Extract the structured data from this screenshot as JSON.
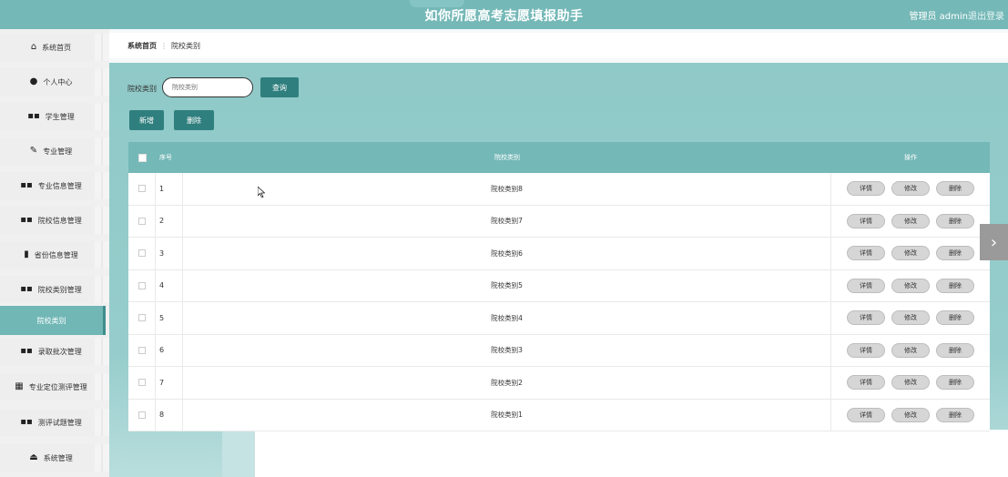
{
  "header": {
    "title": "如你所愿高考志愿填报助手",
    "admin_label": "管理员 admin",
    "logout_label": "退出登录"
  },
  "sidebar": {
    "items": [
      {
        "label": "系统首页",
        "icon": "home-icon"
      },
      {
        "label": "个人中心",
        "icon": "user-icon"
      },
      {
        "label": "学生管理",
        "icon": "grid-icon"
      },
      {
        "label": "专业管理",
        "icon": "edit-icon"
      },
      {
        "label": "专业信息管理",
        "icon": "grid-icon"
      },
      {
        "label": "院校信息管理",
        "icon": "grid-icon"
      },
      {
        "label": "省份信息管理",
        "icon": "chart-icon"
      },
      {
        "label": "院校类别管理",
        "icon": "grid-icon"
      },
      {
        "label": "录取批次管理",
        "icon": "grid-icon"
      },
      {
        "label": "专业定位测评管理",
        "icon": "table-icon"
      },
      {
        "label": "测评试题管理",
        "icon": "grid-icon"
      },
      {
        "label": "系统管理",
        "icon": "system-icon"
      }
    ],
    "active_sub": "院校类别"
  },
  "breadcrumb": {
    "home": "系统首页",
    "separator": "⋮",
    "current": "院校类别"
  },
  "search": {
    "label": "院校类别",
    "placeholder": "院校类别",
    "query_button": "查询"
  },
  "actions": {
    "add_button": "新增",
    "delete_button": "删除"
  },
  "table": {
    "headers": {
      "index": "序号",
      "name": "院校类别",
      "ops": "操作"
    },
    "op_labels": {
      "detail": "详情",
      "edit": "修改",
      "delete": "删除"
    },
    "rows": [
      {
        "index": "1",
        "name": "院校类别8"
      },
      {
        "index": "2",
        "name": "院校类别7"
      },
      {
        "index": "3",
        "name": "院校类别6"
      },
      {
        "index": "4",
        "name": "院校类别5"
      },
      {
        "index": "5",
        "name": "院校类别4"
      },
      {
        "index": "6",
        "name": "院校类别3"
      },
      {
        "index": "7",
        "name": "院校类别2"
      },
      {
        "index": "8",
        "name": "院校类别1"
      }
    ]
  },
  "colors": {
    "header": "#74b8b7",
    "button": "#2f7f7e",
    "table_header": "#74b8b7"
  },
  "scroll_arrow": "›"
}
